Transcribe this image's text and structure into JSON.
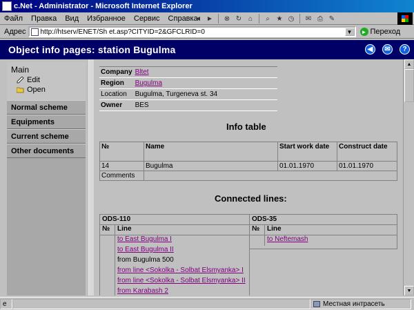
{
  "window": {
    "title": "c.Net - Administrator - Microsoft Internet Explorer"
  },
  "menu": {
    "items": [
      "Файл",
      "Правка",
      "Вид",
      "Избранное",
      "Сервис",
      "Справка"
    ]
  },
  "address": {
    "label": "Адрес",
    "url": "http://htserv/ENET/Sh et.asp?CITYID=2&GFCLRID=0",
    "go_label": "Переход"
  },
  "header": {
    "title": "Object info pages: station  Bugulma"
  },
  "sidebar": {
    "main_label": "Main",
    "sub_items": [
      "Edit",
      "Open"
    ],
    "nav_items": [
      "Normal scheme",
      "Equipments",
      "Current scheme",
      "Other documents"
    ]
  },
  "company_table": {
    "rows": [
      {
        "key": "Company",
        "value": "Bltet",
        "link": true
      },
      {
        "key": "Region",
        "value": "Bugulma",
        "link": true
      },
      {
        "key": "Location",
        "value": "Bugulma, Turgeneva st. 34",
        "link": false
      },
      {
        "key": "Owner",
        "value": "BES",
        "link": false
      }
    ]
  },
  "info": {
    "heading": "Info table",
    "columns": [
      "№",
      "Name",
      "Start work date",
      "Construct date"
    ],
    "row": [
      "14",
      "Bugulma",
      "01.01.1970",
      "01.01.1970"
    ],
    "comments_label": "Comments"
  },
  "connected": {
    "heading": "Connected lines:",
    "groups": [
      {
        "name": "ODS-110",
        "col1": "№",
        "col2": "Line",
        "lines": [
          {
            "text": "to East Bugulma I",
            "link": true
          },
          {
            "text": "to East Bugulma II",
            "link": true
          },
          {
            "text": "from Bugulma 500",
            "link": false
          },
          {
            "text": "from line <Sokolka - Solbat Elsmyanka> I",
            "link": true
          },
          {
            "text": "from line <Sokolka - Solbat Elsmyanka> II",
            "link": true
          },
          {
            "text": "from Karabash 2",
            "link": true
          }
        ]
      },
      {
        "name": "ODS-35",
        "col1": "№",
        "col2": "Line",
        "lines": [
          {
            "text": "to Neftemash",
            "link": true
          }
        ]
      }
    ]
  },
  "status": {
    "text": "Местная интрасеть"
  }
}
